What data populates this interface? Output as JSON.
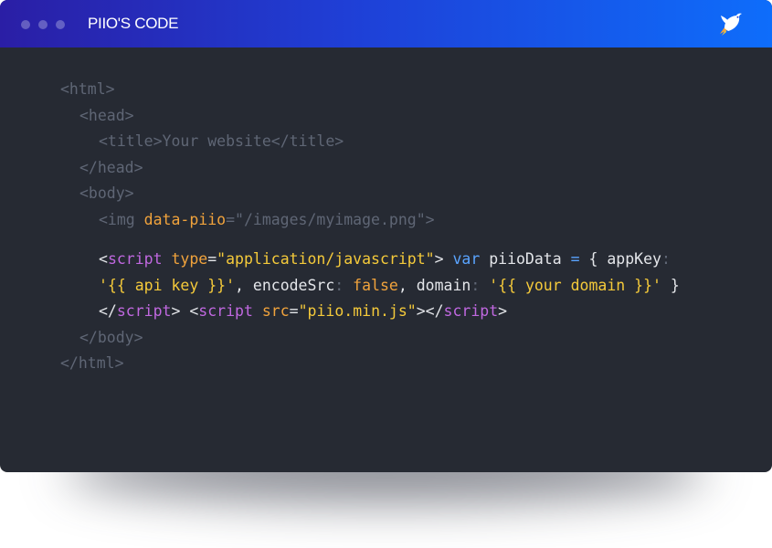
{
  "window": {
    "title": "PIIO'S CODE",
    "logo_icon": "bird-rocket-icon",
    "gradient": [
      "#2a1ea5",
      "#0e6dfb"
    ],
    "traffic_dots": [
      "dot",
      "dot",
      "dot"
    ]
  },
  "code": {
    "html_open": "<html>",
    "head_open": "<head>",
    "title_open": "<title>",
    "title_text": "Your website",
    "title_close": "</title>",
    "head_close": "</head>",
    "body_open": "<body>",
    "img_open": "<img ",
    "img_attr": "data-piio",
    "img_eq": "=",
    "img_value": "\"/images/myimage.png\"",
    "img_close": ">",
    "script1_lt": "<",
    "script1_tag": "script",
    "script1_attr": " type",
    "script1_eq": "=",
    "script1_value": "\"application/javascript\"",
    "script1_gt": "> ",
    "var_kw": "var",
    "var_name": " piioData ",
    "var_eq": "=",
    "brace_open": " { ",
    "key_appkey": "appKey",
    "colon1": ":",
    "appkey_value": "'{{ api key }}'",
    "comma1": ", ",
    "key_encodesrc": "encodeSrc",
    "colon2": ": ",
    "encodesrc_value": "false",
    "comma2": ", ",
    "key_domain": "domain",
    "colon3": ": ",
    "domain_value": "'{{ your domain }}'",
    "brace_close": " }",
    "script1_close_lt": "</",
    "script1_close_tag": "script",
    "script1_close_gt": ">",
    "space": " ",
    "script2_lt": "<",
    "script2_tag": "script",
    "script2_attr": " src",
    "script2_eq": "=",
    "script2_value": "\"piio.min.js\"",
    "script2_mid": "></",
    "script2_close_tag": "script",
    "script2_gt": ">",
    "body_close": "</body>",
    "html_close": "</html>"
  }
}
